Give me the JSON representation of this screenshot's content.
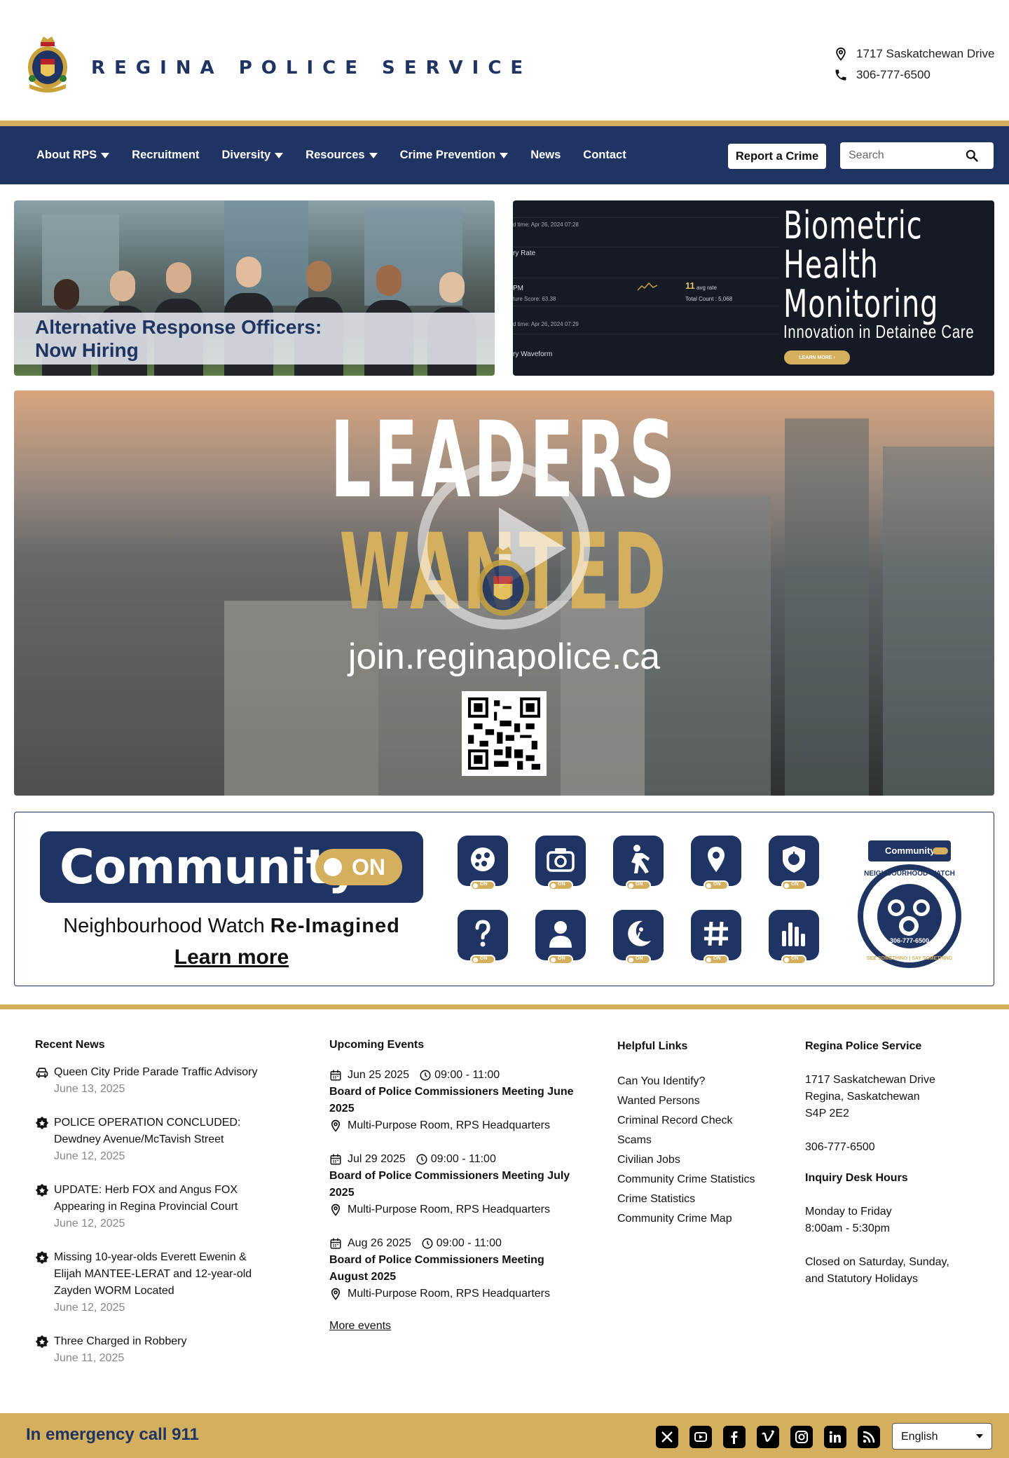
{
  "header": {
    "brand": "REGINA POLICE SERVICE",
    "address": "1717 Saskatchewan Drive",
    "phone": "306-777-6500"
  },
  "nav": {
    "items": [
      {
        "label": "About RPS",
        "dropdown": true
      },
      {
        "label": "Recruitment",
        "dropdown": false
      },
      {
        "label": "Diversity",
        "dropdown": true
      },
      {
        "label": "Resources",
        "dropdown": true
      },
      {
        "label": "Crime Prevention",
        "dropdown": true
      },
      {
        "label": "News",
        "dropdown": false
      },
      {
        "label": "Contact",
        "dropdown": false
      }
    ],
    "report_button": "Report a Crime",
    "search_placeholder": "Search"
  },
  "hero": {
    "left_caption_line1": "Alternative Response Officers:",
    "left_caption_line2": "Now Hiring",
    "right_title_1": "Biometric",
    "right_title_2": "Health",
    "right_title_3": "Monitoring",
    "right_subtitle": "Innovation in Detainee Care",
    "right_button": "LEARN MORE",
    "dash_labels": [
      "ry Rate",
      "PM",
      "ry Waveform"
    ],
    "dash_small": [
      "d time: Apr 26, 2024 07:28",
      "ture Score: 63.38",
      "d time: Apr 26, 2024 07:29"
    ],
    "dash_metric": "11",
    "dash_metric_unit": "avg rate",
    "dash_metric_total": "Total Count : 5,068"
  },
  "video": {
    "title_part1": "LEADERS",
    "title_part2": "WANTED",
    "url": "join.reginapolice.ca"
  },
  "community": {
    "word": "Community",
    "toggle": "ON",
    "tagline_regular": "Neighbourhood Watch",
    "tagline_bold": "Re-Imagined",
    "learn_more": "Learn more",
    "tile_on": "ON",
    "badge_top": "Community",
    "badge_ring": "NEIGHBOURHOOD WATCH",
    "badge_phone": "306-777-6500",
    "badge_bottom": "SEE SOMETHING | SAY SOMETHING"
  },
  "recent_news": {
    "title": "Recent News",
    "items": [
      {
        "icon": "car-icon",
        "title": "Queen City Pride Parade Traffic Advisory",
        "date": "June 13, 2025"
      },
      {
        "icon": "badge-icon",
        "title": "POLICE OPERATION CONCLUDED: Dewdney Avenue/McTavish Street",
        "date": "June 12, 2025"
      },
      {
        "icon": "badge-icon",
        "title": "UPDATE: Herb FOX and Angus FOX Appearing in Regina Provincial Court",
        "date": "June 12, 2025"
      },
      {
        "icon": "badge-icon",
        "title": "Missing 10-year-olds Everett Ewenin & Elijah MANTEE-LERAT and 12-year-old Zayden WORM Located",
        "date": "June 12, 2025"
      },
      {
        "icon": "badge-icon",
        "title": "Three Charged in Robbery",
        "date": "June 11, 2025"
      }
    ]
  },
  "upcoming_events": {
    "title": "Upcoming Events",
    "items": [
      {
        "date": "Jun 25 2025",
        "time": "09:00 - 11:00",
        "title": "Board of Police Commissioners Meeting June 2025",
        "location": "Multi-Purpose Room, RPS Headquarters"
      },
      {
        "date": "Jul 29 2025",
        "time": "09:00 - 11:00",
        "title": "Board of Police Commissioners Meeting July 2025",
        "location": "Multi-Purpose Room, RPS Headquarters"
      },
      {
        "date": "Aug 26 2025",
        "time": "09:00 - 11:00",
        "title": "Board of Police Commissioners Meeting August 2025",
        "location": "Multi-Purpose Room, RPS Headquarters"
      }
    ],
    "more": "More events"
  },
  "helpful_links": {
    "title": "Helpful Links",
    "items": [
      "Can You Identify?",
      "Wanted Persons",
      "Criminal Record Check",
      "Scams",
      "Civilian Jobs",
      "Community Crime Statistics",
      "Crime Statistics",
      "Community Crime Map"
    ]
  },
  "rps_info": {
    "title": "Regina Police Service",
    "address1": "1717 Saskatchewan Drive",
    "address2": "Regina, Saskatchewan",
    "postal": "S4P 2E2",
    "phone": "306-777-6500",
    "hours_title": "Inquiry Desk Hours",
    "hours_days": "Monday to Friday",
    "hours_time": "8:00am - 5:30pm",
    "closed_1": "Closed on Saturday, Sunday,",
    "closed_2": "and Statutory Holidays"
  },
  "bottom_bar": {
    "emergency": "In emergency call 911",
    "social": [
      "x-icon",
      "youtube-icon",
      "facebook-icon",
      "vimeo-icon",
      "instagram-icon",
      "linkedin-icon",
      "rss-icon"
    ],
    "language": "English"
  },
  "colors": {
    "navy": "#1f3463",
    "gold": "#d4b05e"
  }
}
